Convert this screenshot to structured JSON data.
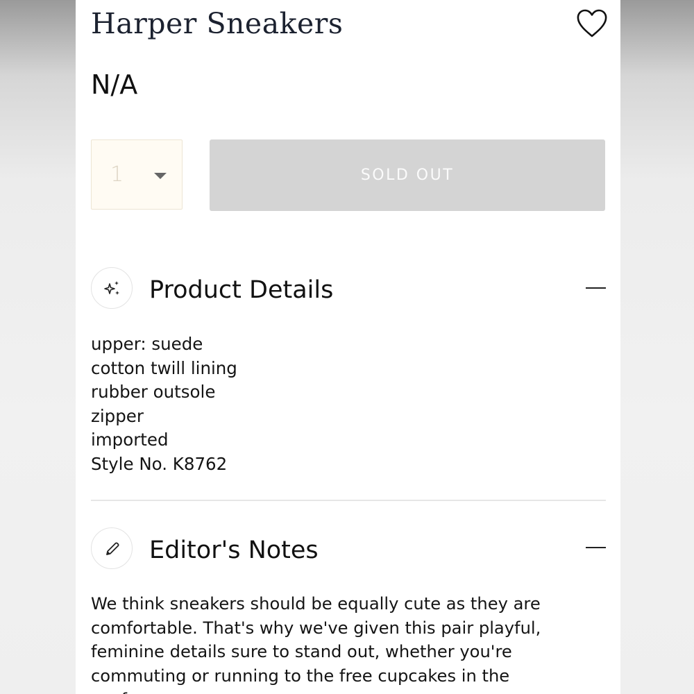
{
  "product": {
    "title": "Harper Sneakers",
    "price": "N/A",
    "wishlist_icon": "heart-icon"
  },
  "purchase": {
    "quantity": "1",
    "quantity_caret_icon": "caret-down-icon",
    "button_label": "SOLD OUT",
    "button_state": "disabled"
  },
  "sections": {
    "details": {
      "icon": "sparkles-icon",
      "title": "Product Details",
      "toggle_icon": "minus-icon",
      "items": [
        "upper: suede",
        "cotton twill lining",
        "rubber outsole",
        "zipper",
        "imported",
        "Style No. K8762"
      ]
    },
    "notes": {
      "icon": "pencil-icon",
      "title": "Editor's Notes",
      "toggle_icon": "minus-icon",
      "text": "We think sneakers should be equally cute as they are comfortable. That's why we've given this pair playful, feminine details sure to stand out, whether you're commuting or running to the free cupcakes in the conference room."
    }
  },
  "colors": {
    "title": "#1c2230",
    "sold_out_bg": "#d4d4d4",
    "quantity_bg": "#fffbf3",
    "text": "#141414"
  }
}
